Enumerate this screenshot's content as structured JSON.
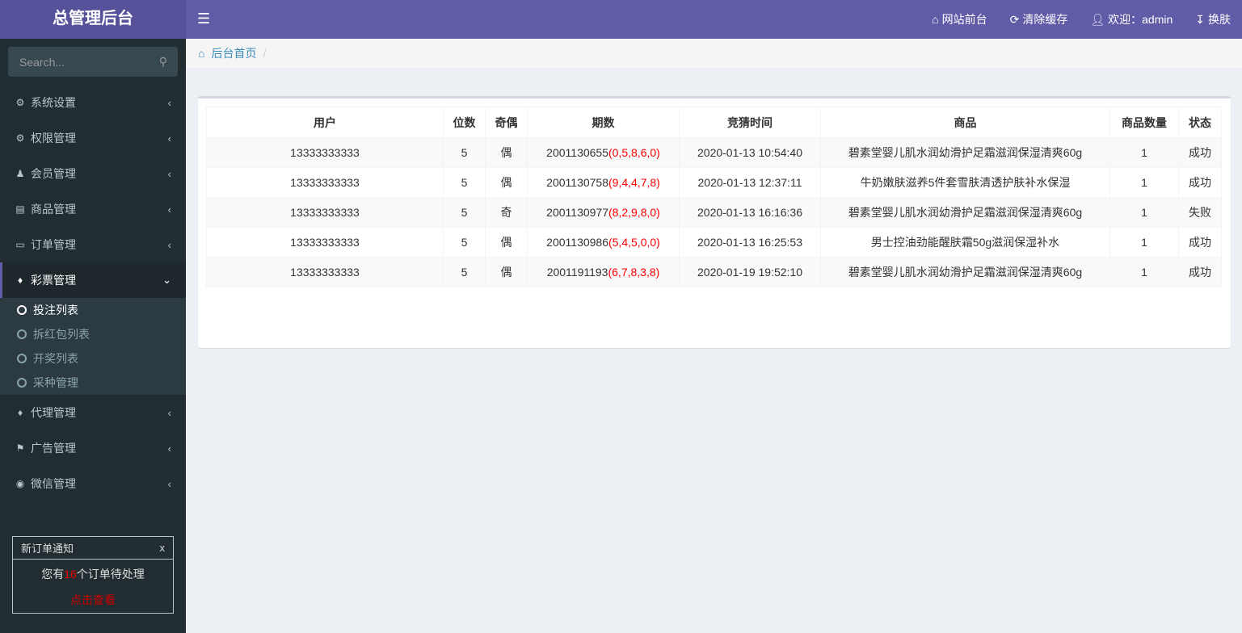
{
  "header": {
    "logo": "总管理后台",
    "nav": [
      {
        "icon": "home-icon",
        "label": "网站前台"
      },
      {
        "icon": "refresh-icon",
        "label": "清除缓存"
      },
      {
        "icon": "user-icon",
        "label": "欢迎：admin"
      },
      {
        "icon": "skin-icon",
        "label": "换肤"
      }
    ]
  },
  "sidebar": {
    "search_placeholder": "Search...",
    "items": [
      {
        "icon": "gear-icon",
        "label": "系统设置"
      },
      {
        "icon": "gears-icon",
        "label": "权限管理"
      },
      {
        "icon": "user-icon",
        "label": "会员管理"
      },
      {
        "icon": "book-icon",
        "label": "商品管理"
      },
      {
        "icon": "money-icon",
        "label": "订单管理"
      },
      {
        "icon": "bell-icon",
        "label": "彩票管理",
        "active": true,
        "sub": [
          {
            "label": "投注列表",
            "active": true
          },
          {
            "label": "拆红包列表"
          },
          {
            "label": "开奖列表"
          },
          {
            "label": "采种管理"
          }
        ]
      },
      {
        "icon": "bell-icon",
        "label": "代理管理"
      },
      {
        "icon": "flag-icon",
        "label": "广告管理"
      },
      {
        "icon": "wechat-icon",
        "label": "微信管理"
      }
    ],
    "notice": {
      "title": "新订单通知",
      "close": "x",
      "prefix": "您有",
      "count": "16",
      "suffix": "个订单待处理",
      "link": "点击查看"
    }
  },
  "breadcrumb": {
    "home": "后台首页",
    "sep": "/"
  },
  "table": {
    "headers": [
      "用户",
      "位数",
      "奇偶",
      "期数",
      "竞猜时间",
      "商品",
      "商品数量",
      "状态"
    ],
    "rows": [
      [
        "13333333333",
        "5",
        "偶",
        "2001130655",
        "(0,5,8,6,0)",
        "2020-01-13 10:54:40",
        "碧素堂婴儿肌水润幼滑护足霜滋润保湿清爽60g",
        "1",
        "成功"
      ],
      [
        "13333333333",
        "5",
        "偶",
        "2001130758",
        "(9,4,4,7,8)",
        "2020-01-13 12:37:11",
        "牛奶嫩肤滋养5件套雪肤清透护肤补水保湿",
        "1",
        "成功"
      ],
      [
        "13333333333",
        "5",
        "奇",
        "2001130977",
        "(8,2,9,8,0)",
        "2020-01-13 16:16:36",
        "碧素堂婴儿肌水润幼滑护足霜滋润保湿清爽60g",
        "1",
        "失败"
      ],
      [
        "13333333333",
        "5",
        "偶",
        "2001130986",
        "(5,4,5,0,0)",
        "2020-01-13 16:25:53",
        "男士控油劲能醒肤霜50g滋润保湿补水",
        "1",
        "成功"
      ],
      [
        "13333333333",
        "5",
        "偶",
        "2001191193",
        "(6,7,8,3,8)",
        "2020-01-19 19:52:10",
        "碧素堂婴儿肌水润幼滑护足霜滋润保湿清爽60g",
        "1",
        "成功"
      ]
    ]
  },
  "colors": {
    "header": "#605ca8",
    "sidebar": "#222d32",
    "accent": "#3c8dbc",
    "highlight": "#ff0000"
  }
}
